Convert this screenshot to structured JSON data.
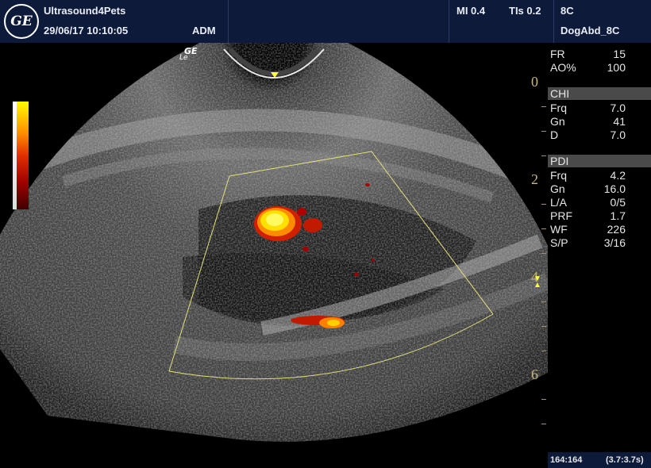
{
  "header": {
    "logo_text": "GE",
    "station": "Ultrasound4Pets",
    "datetime": "29/06/17 10:10:05",
    "operator": "ADM",
    "mi": "MI 0.4",
    "tis": "TIs 0.2",
    "probe": "8C",
    "preset": "DogAbd_8C"
  },
  "scan": {
    "probe_mark": "GE",
    "probe_submark": "Le"
  },
  "panel": {
    "rows_top": [
      {
        "label": "FR",
        "value": "15"
      },
      {
        "label": "AO%",
        "value": "100"
      }
    ],
    "chi_title": "CHI",
    "chi_rows": [
      {
        "label": "Frq",
        "value": "7.0"
      },
      {
        "label": "Gn",
        "value": "41"
      },
      {
        "label": "D",
        "value": "7.0"
      }
    ],
    "pdi_title": "PDI",
    "pdi_rows": [
      {
        "label": "Frq",
        "value": "4.2"
      },
      {
        "label": "Gn",
        "value": "16.0"
      },
      {
        "label": "L/A",
        "value": "0/5"
      },
      {
        "label": "PRF",
        "value": "1.7"
      },
      {
        "label": "WF",
        "value": "226"
      },
      {
        "label": "S/P",
        "value": "3/16"
      }
    ]
  },
  "depth_scale": [
    "0",
    "2",
    "4",
    "6"
  ],
  "footer": {
    "frames": "164:164",
    "time": "(3.7:3.7s)"
  }
}
